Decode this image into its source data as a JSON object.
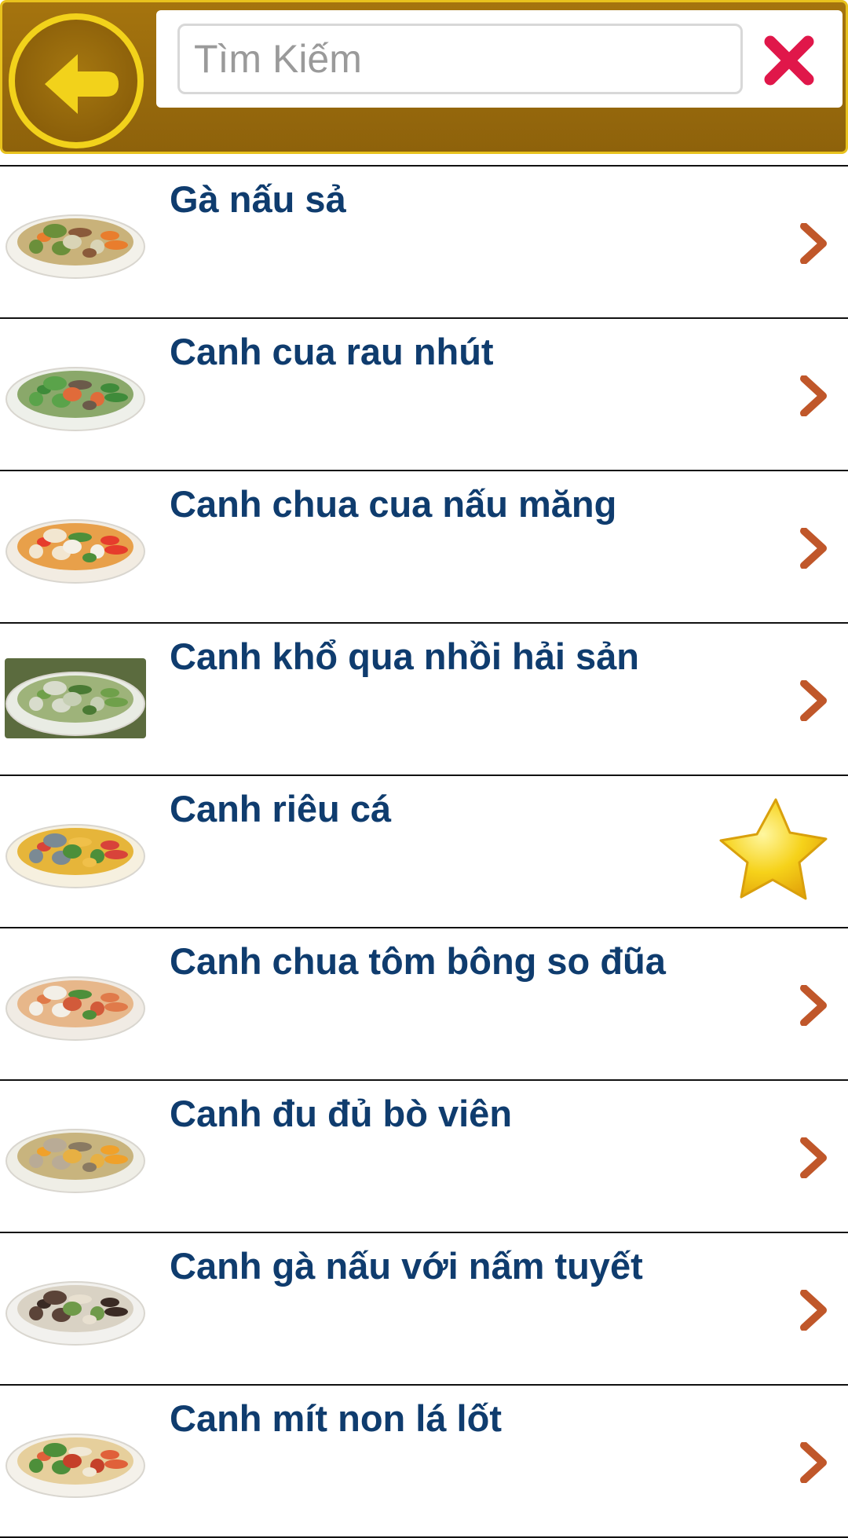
{
  "header": {
    "search": {
      "placeholder": "Tìm Kiếm",
      "value": ""
    }
  },
  "colors": {
    "header_bg": "#96660c",
    "header_border": "#e8c21d",
    "back_icon": "#f2d21b",
    "title_text": "#0f3c6e",
    "chevron": "#c0572a",
    "clear_icon": "#e0174a"
  },
  "items": [
    {
      "title": "Gà nấu sả",
      "icon": "chevron-right-icon",
      "plate": "#f3f1ea",
      "soup": "#c9b27a",
      "dots": [
        "#e97d2d",
        "#6b8f3a",
        "#8a5a3a",
        "#d9d4b6"
      ]
    },
    {
      "title": "Canh cua rau nhút",
      "icon": "chevron-right-icon",
      "plate": "#eef0ea",
      "soup": "#8aa86a",
      "dots": [
        "#3f8b3a",
        "#5aa34a",
        "#6b5a4a",
        "#e06b3a"
      ]
    },
    {
      "title": "Canh chua cua nấu măng",
      "icon": "chevron-right-icon",
      "plate": "#f2ece2",
      "soup": "#e8a04a",
      "dots": [
        "#e63c2c",
        "#f2e6d0",
        "#4d8f3a",
        "#f4f0e6"
      ]
    },
    {
      "title": "Canh khổ qua nhồi hải sản",
      "icon": "chevron-right-icon",
      "plate": "#5b6b3e",
      "soup": "#9eb37a",
      "dots": [
        "#6fa04a",
        "#d8dccc",
        "#4a7a34",
        "#c6cfb4"
      ]
    },
    {
      "title": "Canh riêu cá",
      "icon": "star-icon",
      "plate": "#f6f0df",
      "soup": "#e6b53a",
      "dots": [
        "#d8433a",
        "#7b8a94",
        "#f0c04a",
        "#4d8f3a"
      ]
    },
    {
      "title": "Canh chua tôm bông so đũa",
      "icon": "chevron-right-icon",
      "plate": "#f0ebe4",
      "soup": "#e7b78a",
      "dots": [
        "#e07a4a",
        "#f3efe7",
        "#4d8f3a",
        "#d25a3a"
      ]
    },
    {
      "title": "Canh đu đủ bò viên",
      "icon": "chevron-right-icon",
      "plate": "#efeee6",
      "soup": "#c8b47e",
      "dots": [
        "#f0a12a",
        "#b9ab96",
        "#8a7a62",
        "#e7b043"
      ]
    },
    {
      "title": "Canh gà nấu với nấm tuyết",
      "icon": "chevron-right-icon",
      "plate": "#f2f1ee",
      "soup": "#d9d2c4",
      "dots": [
        "#3a2a24",
        "#5b4338",
        "#e8e0d0",
        "#6f9a4a"
      ]
    },
    {
      "title": "Canh mít non lá lốt",
      "icon": "chevron-right-icon",
      "plate": "#f4f1ea",
      "soup": "#e6cf9c",
      "dots": [
        "#e0603a",
        "#4d8f3a",
        "#f1e9d6",
        "#c5402a"
      ]
    }
  ]
}
